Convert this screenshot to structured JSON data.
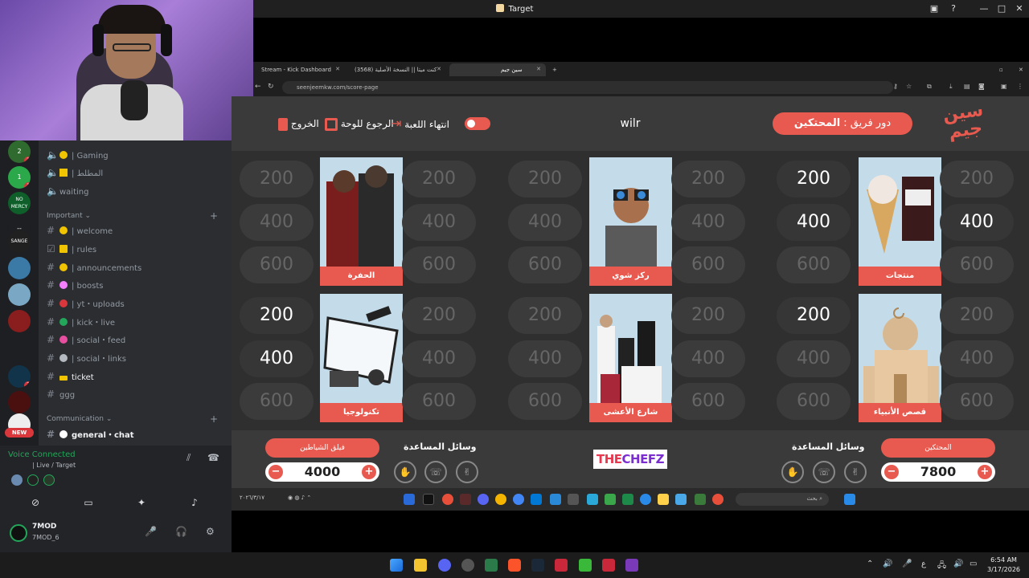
{
  "window": {
    "title": "Target"
  },
  "browser": {
    "tabs": [
      {
        "label": "Stream - Kick Dashboard"
      },
      {
        "label": "(3568) كنت ميتا || النسخة الأصلية"
      },
      {
        "label": "سين جيم"
      }
    ],
    "url": "seenjeemkw.com/score-page"
  },
  "discord": {
    "servers": [
      {
        "label": "2",
        "badge": "2"
      },
      {
        "label": "1",
        "badge": "1"
      },
      {
        "label": "NO MERCY",
        "badge": ""
      },
      {
        "label": "--",
        "badge": ""
      },
      {
        "label": "SANGE",
        "badge": ""
      },
      {
        "label": "",
        "badge": ""
      },
      {
        "label": "",
        "badge": ""
      },
      {
        "label": "",
        "badge": ""
      },
      {
        "label": "",
        "badge": "7"
      },
      {
        "label": "",
        "badge": ""
      }
    ],
    "new_badge": "NEW",
    "voice_channels": [
      {
        "label": "| Gaming",
        "color": "#f0c400"
      },
      {
        "label": "| المطلط",
        "color": "#f0c400"
      },
      {
        "label": "waiting",
        "color": ""
      }
    ],
    "category_important": "Important",
    "text_channels": [
      {
        "label": "| welcome",
        "color": "#f0c400"
      },
      {
        "label": "| rules",
        "color": "#f0c400"
      },
      {
        "label": "| announcements",
        "color": "#f0c400"
      },
      {
        "label": "| boosts",
        "color": "#f47fff"
      },
      {
        "label": "| yt・uploads",
        "color": "#da373c"
      },
      {
        "label": "| kick・live",
        "color": "#23a55a"
      },
      {
        "label": "| social・feed",
        "color": "#e84fa0"
      },
      {
        "label": "| social・links",
        "color": "#b5bac1"
      },
      {
        "label": "ticket",
        "color": "#f0c400"
      },
      {
        "label": "ggg",
        "color": ""
      }
    ],
    "category_communication": "Communication",
    "general_chat": "general・chat",
    "voice_connected": "Voice Connected",
    "voice_channel_path": "| Live / Target",
    "user": {
      "name": "7MOD",
      "status": "7MOD_6"
    }
  },
  "game": {
    "exit_label": "الخروج",
    "back_label": "الرجوع للوحة",
    "end_label": "انتهاء اللعبة",
    "current_team": "wilr",
    "turn_prefix": "دور فريق :",
    "turn_team": "المحتكين",
    "logo_text": "سين جيم",
    "categories": [
      {
        "label": "الحفرة",
        "left_used": [
          true,
          true,
          true
        ],
        "right_used": [
          true,
          true,
          true
        ]
      },
      {
        "label": "ركز شوي",
        "left_used": [
          true,
          true,
          true
        ],
        "right_used": [
          true,
          true,
          true
        ]
      },
      {
        "label": "منتجات",
        "left_used": [
          false,
          false,
          true
        ],
        "right_used": [
          true,
          false,
          true
        ]
      },
      {
        "label": "تكنولوجيا",
        "left_used": [
          false,
          false,
          true
        ],
        "right_used": [
          true,
          true,
          true
        ]
      },
      {
        "label": "شارع الأعشى",
        "left_used": [
          true,
          true,
          true
        ],
        "right_used": [
          true,
          true,
          true
        ]
      },
      {
        "label": "قصص الأنبياء",
        "left_used": [
          false,
          true,
          true
        ],
        "right_used": [
          true,
          true,
          true
        ]
      }
    ],
    "values": [
      "200",
      "400",
      "600"
    ],
    "help_label": "وسائل المساعدة",
    "team_left": {
      "name": "فيلق الشياطين",
      "score": "4000"
    },
    "team_right": {
      "name": "المحتكين",
      "score": "7800"
    },
    "brand_left": "THE",
    "brand_right": "CHEFZ",
    "plus": "+",
    "minus": "−"
  },
  "inner_taskbar": {
    "search": "بحث",
    "date": "٢٠٢٦/٣/١٧"
  },
  "taskbar": {
    "time": "6:54 AM",
    "date": "3/17/2026"
  },
  "colors": {
    "accent": "#e85a4f",
    "card_bg": "#c4dcea"
  }
}
